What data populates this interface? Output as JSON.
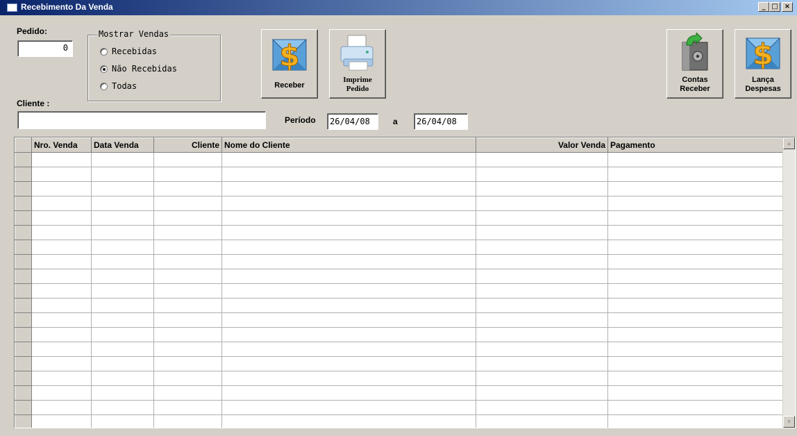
{
  "window": {
    "title": "Recebimento Da Venda",
    "controls": [
      "_",
      "□",
      "×"
    ]
  },
  "form": {
    "pedido_label": "Pedido:",
    "pedido_value": "0",
    "group_title": "Mostrar Vendas",
    "options": [
      {
        "label": "Recebidas",
        "selected": false
      },
      {
        "label": "Não Recebidas",
        "selected": true
      },
      {
        "label": "Todas",
        "selected": false
      }
    ],
    "cliente_label": "Cliente :",
    "cliente_value": "",
    "periodo_label": "Período",
    "periodo_from": "26/04/08",
    "periodo_sep": "a",
    "periodo_to": "26/04/08"
  },
  "toolbar": {
    "receber": "Receber",
    "imprime_line1": "Imprime",
    "imprime_line2": "Pedido",
    "contas_line1": "Contas",
    "contas_line2": "Receber",
    "lanca_line1": "Lança",
    "lanca_line2": "Despesas"
  },
  "icons": {
    "receber": "money-envelope-icon",
    "imprime": "printer-icon",
    "contas": "safe-icon",
    "lanca": "money-envelope-icon"
  },
  "colors": {
    "title_start": "#0a246a",
    "title_end": "#a6caf0",
    "dollar": "#f0b020"
  },
  "table": {
    "columns": [
      "Nro. Venda",
      "Data Venda",
      "Cliente",
      "Nome do Cliente",
      "Valor Venda",
      "Pagamento"
    ]
  }
}
